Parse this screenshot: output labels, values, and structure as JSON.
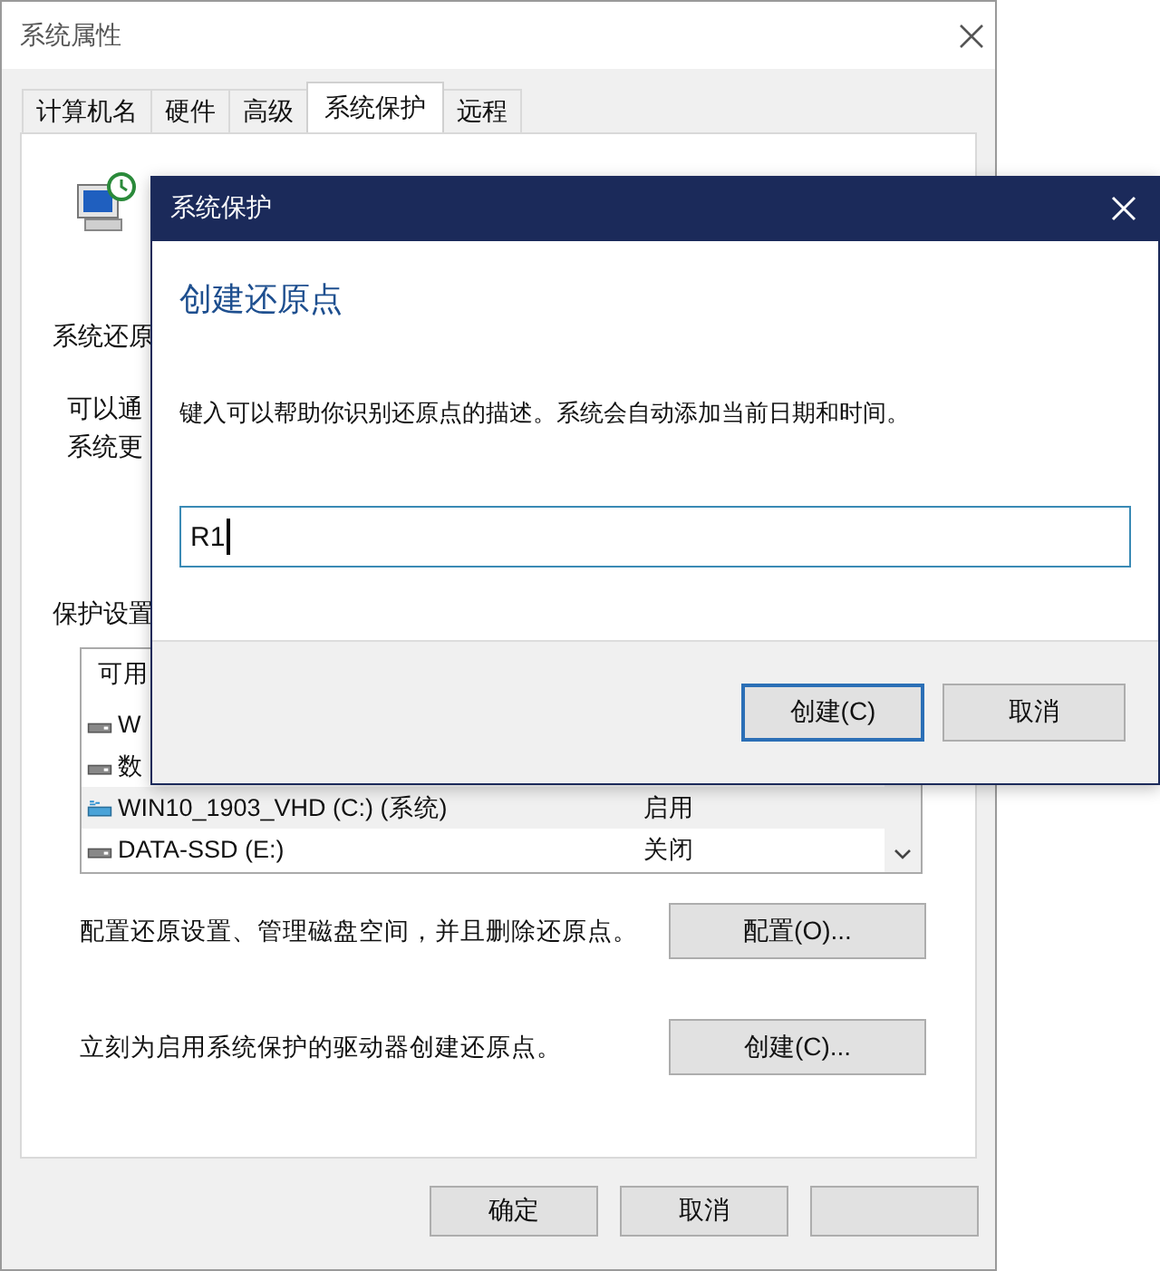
{
  "window": {
    "title": "系统属性"
  },
  "tabs": [
    {
      "label": "计算机名",
      "selected": false
    },
    {
      "label": "硬件",
      "selected": false
    },
    {
      "label": "高级",
      "selected": false
    },
    {
      "label": "系统保护",
      "selected": true
    },
    {
      "label": "远程",
      "selected": false
    }
  ],
  "restore": {
    "heading": "系统还原",
    "lines": [
      "可以通",
      "系统更"
    ]
  },
  "protection": {
    "heading": "保护设置",
    "column": "可用",
    "drives": [
      {
        "name": "W",
        "kind": "drive",
        "selected": false
      },
      {
        "name": "数",
        "kind": "drive",
        "selected": false
      },
      {
        "name": "WIN10_1903_VHD (C:) (系统)",
        "status": "启用",
        "kind": "system",
        "selected": true
      },
      {
        "name": "DATA-SSD (E:)",
        "status": "关闭",
        "kind": "drive",
        "selected": false
      }
    ]
  },
  "actions": [
    {
      "text": "配置还原设置、管理磁盘空间，并且删除还原点。",
      "button": "配置(O)..."
    },
    {
      "text": "立刻为启用系统保护的驱动器创建还原点。",
      "button": "创建(C)..."
    }
  ],
  "buttons": [
    {
      "kind": "text",
      "label": "确定"
    },
    {
      "kind": "text",
      "label": "取消"
    },
    {
      "kind": "blank"
    }
  ],
  "dialog": {
    "title": "系统保护",
    "heading": "创建还原点",
    "description": "键入可以帮助你识别还原点的描述。系统会自动添加当前日期和时间。",
    "input": {
      "value": "R1"
    },
    "buttons": [
      {
        "label": "创建(C)",
        "default": true
      },
      {
        "label": "取消",
        "default": false
      }
    ]
  }
}
